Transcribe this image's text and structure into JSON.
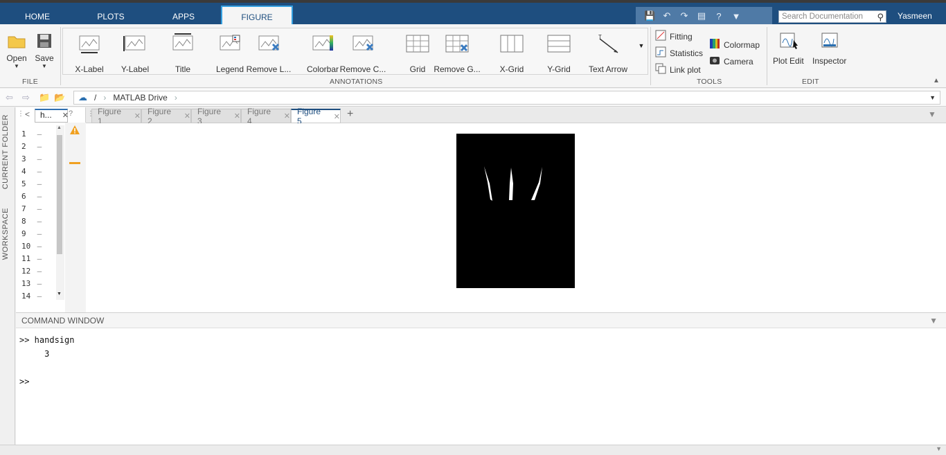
{
  "top_tabs": [
    {
      "label": "HOME"
    },
    {
      "label": "PLOTS"
    },
    {
      "label": "APPS"
    },
    {
      "label": "FIGURE"
    }
  ],
  "search": {
    "placeholder": "Search Documentation"
  },
  "user": {
    "name": "Yasmeen"
  },
  "ribbon": {
    "file": {
      "open": "Open",
      "save": "Save",
      "section": "FILE"
    },
    "annotations": {
      "section": "ANNOTATIONS",
      "buttons": [
        "X-Label",
        "Y-Label",
        "Title",
        "Legend",
        "Remove L...",
        "Colorbar",
        "Remove C...",
        "Grid",
        "Remove G...",
        "X-Grid",
        "Y-Grid",
        "Text Arrow"
      ]
    },
    "tools": {
      "section": "TOOLS",
      "fitting": "Fitting",
      "statistics": "Statistics",
      "link_plot": "Link plot",
      "colormap": "Colormap",
      "camera": "Camera"
    },
    "edit": {
      "section": "EDIT",
      "plot_edit": "Plot Edit",
      "inspector": "Inspector"
    }
  },
  "address": {
    "root": "/",
    "path": "MATLAB Drive"
  },
  "left_panel": {
    "current_folder": "CURRENT FOLDER",
    "workspace": "WORKSPACE"
  },
  "editor": {
    "tab": "h...",
    "lines": [
      "1",
      "2",
      "3",
      "4",
      "5",
      "6",
      "7",
      "8",
      "9",
      "10",
      "11",
      "12",
      "13",
      "14"
    ]
  },
  "figure_tabs": [
    "Figure 1",
    "Figure 2",
    "Figure 3",
    "Figure 4",
    "Figure 5"
  ],
  "active_figure": "Figure 5",
  "command_window": {
    "title": "COMMAND WINDOW",
    "lines": [
      ">> handsign",
      "     3",
      "",
      ">>"
    ]
  }
}
